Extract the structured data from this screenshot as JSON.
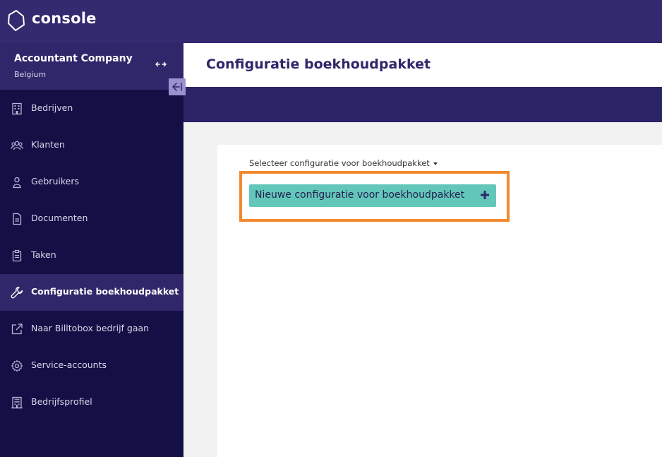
{
  "app": {
    "name": "console"
  },
  "sidebar": {
    "company_name": "Accountant Company",
    "company_country": "Belgium",
    "items": [
      {
        "label": "Bedrijven",
        "icon": "building-icon",
        "active": false
      },
      {
        "label": "Klanten",
        "icon": "users-group-icon",
        "active": false
      },
      {
        "label": "Gebruikers",
        "icon": "user-icon",
        "active": false
      },
      {
        "label": "Documenten",
        "icon": "document-icon",
        "active": false
      },
      {
        "label": "Taken",
        "icon": "clipboard-icon",
        "active": false
      },
      {
        "label": "Configuratie boekhoudpakket",
        "icon": "wrench-icon",
        "active": true
      },
      {
        "label": "Naar Billtobox bedrijf gaan",
        "icon": "external-link-icon",
        "active": false
      },
      {
        "label": "Service-accounts",
        "icon": "gear-icon",
        "active": false
      },
      {
        "label": "Bedrijfsprofiel",
        "icon": "office-building-icon",
        "active": false
      }
    ]
  },
  "header": {
    "title": "Configuratie boekhoudpakket"
  },
  "main": {
    "select_label": "Selecteer configuratie voor boekhoudpakket",
    "new_button_label": "Nieuwe configuratie voor boekhoudpakket"
  },
  "colors": {
    "topbar": "#332a70",
    "sidebar": "#140f45",
    "sidebar_active": "#2f2769",
    "accent_button": "#62c7ba",
    "highlight": "#f28a2f",
    "title": "#2f2769"
  }
}
